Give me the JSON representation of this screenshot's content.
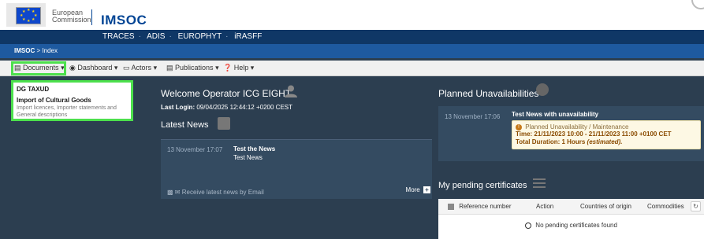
{
  "header": {
    "commission_line1": "European",
    "commission_line2": "Commission",
    "app_name": "IMSOC"
  },
  "systems": [
    "TRACES",
    "ADIS",
    "EUROPHYT",
    "iRASFF"
  ],
  "breadcrumb": {
    "root": "IMSOC",
    "sep": ">",
    "current": "Index"
  },
  "menu": {
    "documents": "Documents",
    "dashboard": "Dashboard",
    "actors": "Actors",
    "publications": "Publications",
    "help": "Help"
  },
  "dropdown": {
    "group": "DG TAXUD",
    "item_title": "Import of Cultural Goods",
    "item_desc": "Import licences, Importer statements and General descriptions"
  },
  "welcome": {
    "title": "Welcome Operator ICG EIGHT",
    "last_login_label": "Last Login:",
    "last_login_value": "09/04/2025 12:44:12 +0200 CEST"
  },
  "news": {
    "title": "Latest News",
    "items": [
      {
        "date": "13 November 17:07",
        "title": "Test the News",
        "body": "Test News"
      }
    ],
    "receive_label": "Receive latest news by Email",
    "more_label": "More"
  },
  "planned": {
    "title": "Planned Unavailabilities",
    "date": "13 November 17:06",
    "headline": "Test News with unavailability",
    "tag": "Planned Unavailability / Maintenance",
    "time": "Time: 21/11/2023 10:00 - 21/11/2023 11:00 +0100 CET",
    "duration_label": "Total Duration: 1 Hours",
    "duration_note": "(estimated)."
  },
  "pending": {
    "title": "My pending certificates",
    "columns": [
      "Reference number",
      "Action",
      "Countries of origin",
      "Commodities"
    ],
    "empty": "No pending certificates found"
  },
  "colors": {
    "brand_blue": "#004494",
    "nav_dark": "#0f3766",
    "highlight_green": "#4ce04c"
  }
}
